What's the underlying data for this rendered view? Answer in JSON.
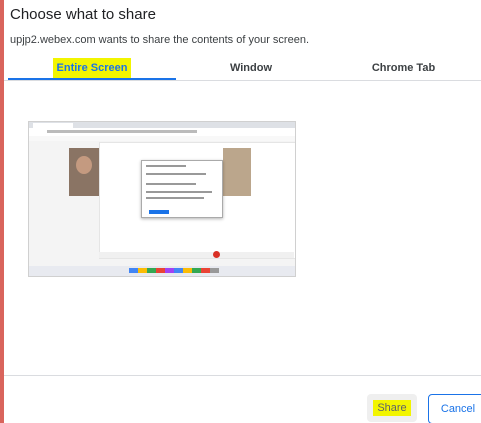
{
  "dialog": {
    "title": "Choose what to share",
    "subtitle": "upjp2.webex.com wants to share the contents of your screen."
  },
  "tabs": [
    {
      "label": "Entire Screen",
      "active": true
    },
    {
      "label": "Window",
      "active": false
    },
    {
      "label": "Chrome Tab",
      "active": false
    }
  ],
  "buttons": {
    "share_label": "Share",
    "cancel_label": "Cancel"
  },
  "colors": {
    "accent": "#1a73e8",
    "highlight": "#f2f500",
    "backdrop": "#d9645c"
  }
}
